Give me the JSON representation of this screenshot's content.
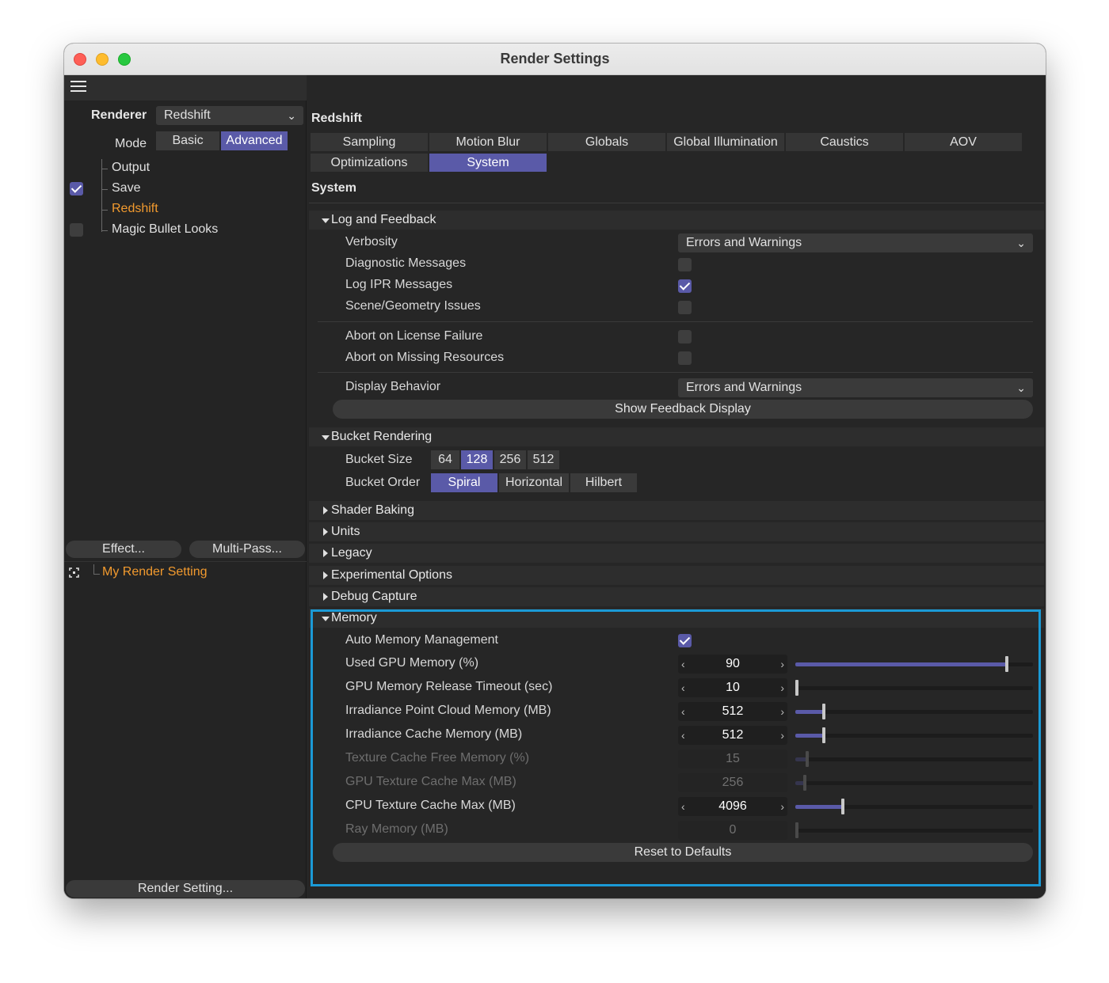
{
  "window": {
    "title": "Render Settings"
  },
  "left": {
    "renderer_label": "Renderer",
    "renderer_value": "Redshift",
    "mode_label": "Mode",
    "modes": [
      "Basic",
      "Advanced"
    ],
    "mode_active": "Advanced",
    "tree": [
      {
        "label": "Output",
        "checkbox": null,
        "active": false
      },
      {
        "label": "Save",
        "checkbox": true,
        "active": false
      },
      {
        "label": "Redshift",
        "checkbox": null,
        "active": true
      },
      {
        "label": "Magic Bullet Looks",
        "checkbox": false,
        "active": false
      }
    ],
    "effect_button": "Effect...",
    "multipass_button": "Multi-Pass...",
    "render_setting_name": "My Render Setting",
    "render_setting_button": "Render Setting..."
  },
  "right": {
    "heading": "Redshift",
    "tabs_row1": [
      "Sampling",
      "Motion Blur",
      "Globals",
      "Global Illumination",
      "Caustics",
      "AOV"
    ],
    "tabs_row2": [
      "Optimizations",
      "System"
    ],
    "active_tab": "System",
    "section_title": "System",
    "log": {
      "title": "Log and Feedback",
      "verbosity_label": "Verbosity",
      "verbosity_value": "Errors and Warnings",
      "diagnostic_label": "Diagnostic Messages",
      "diagnostic_checked": false,
      "log_ipr_label": "Log IPR Messages",
      "log_ipr_checked": true,
      "scene_issues_label": "Scene/Geometry Issues",
      "scene_issues_checked": false,
      "abort_license_label": "Abort on License Failure",
      "abort_license_checked": false,
      "abort_missing_label": "Abort on Missing Resources",
      "abort_missing_checked": false,
      "display_behavior_label": "Display Behavior",
      "display_behavior_value": "Errors and Warnings",
      "show_feedback_button": "Show Feedback Display"
    },
    "bucket": {
      "title": "Bucket Rendering",
      "size_label": "Bucket Size",
      "sizes": [
        "64",
        "128",
        "256",
        "512"
      ],
      "size_active": "128",
      "order_label": "Bucket Order",
      "orders": [
        "Spiral",
        "Horizontal",
        "Hilbert"
      ],
      "order_active": "Spiral"
    },
    "collapsed_sections": [
      "Shader Baking",
      "Units",
      "Legacy",
      "Experimental Options",
      "Debug Capture"
    ],
    "memory": {
      "title": "Memory",
      "auto_label": "Auto Memory Management",
      "auto_checked": true,
      "rows": [
        {
          "label": "Used GPU Memory (%)",
          "value": "90",
          "enabled": true,
          "level": 0.89
        },
        {
          "label": "GPU Memory Release Timeout (sec)",
          "value": "10",
          "enabled": true,
          "level": 0.0
        },
        {
          "label": "Irradiance Point Cloud Memory (MB)",
          "value": "512",
          "enabled": true,
          "level": 0.12
        },
        {
          "label": "Irradiance Cache Memory (MB)",
          "value": "512",
          "enabled": true,
          "level": 0.12
        },
        {
          "label": "Texture Cache Free Memory (%)",
          "value": "15",
          "enabled": false,
          "level": 0.05
        },
        {
          "label": "GPU Texture Cache Max (MB)",
          "value": "256",
          "enabled": false,
          "level": 0.04
        },
        {
          "label": "CPU Texture Cache Max (MB)",
          "value": "4096",
          "enabled": true,
          "level": 0.2
        },
        {
          "label": "Ray Memory (MB)",
          "value": "0",
          "enabled": false,
          "level": 0.0
        }
      ],
      "reset_button": "Reset to Defaults"
    }
  },
  "colors": {
    "accent": "#5a5aa8",
    "highlight": "#1b9ad6",
    "active_item": "#f29a2e"
  }
}
